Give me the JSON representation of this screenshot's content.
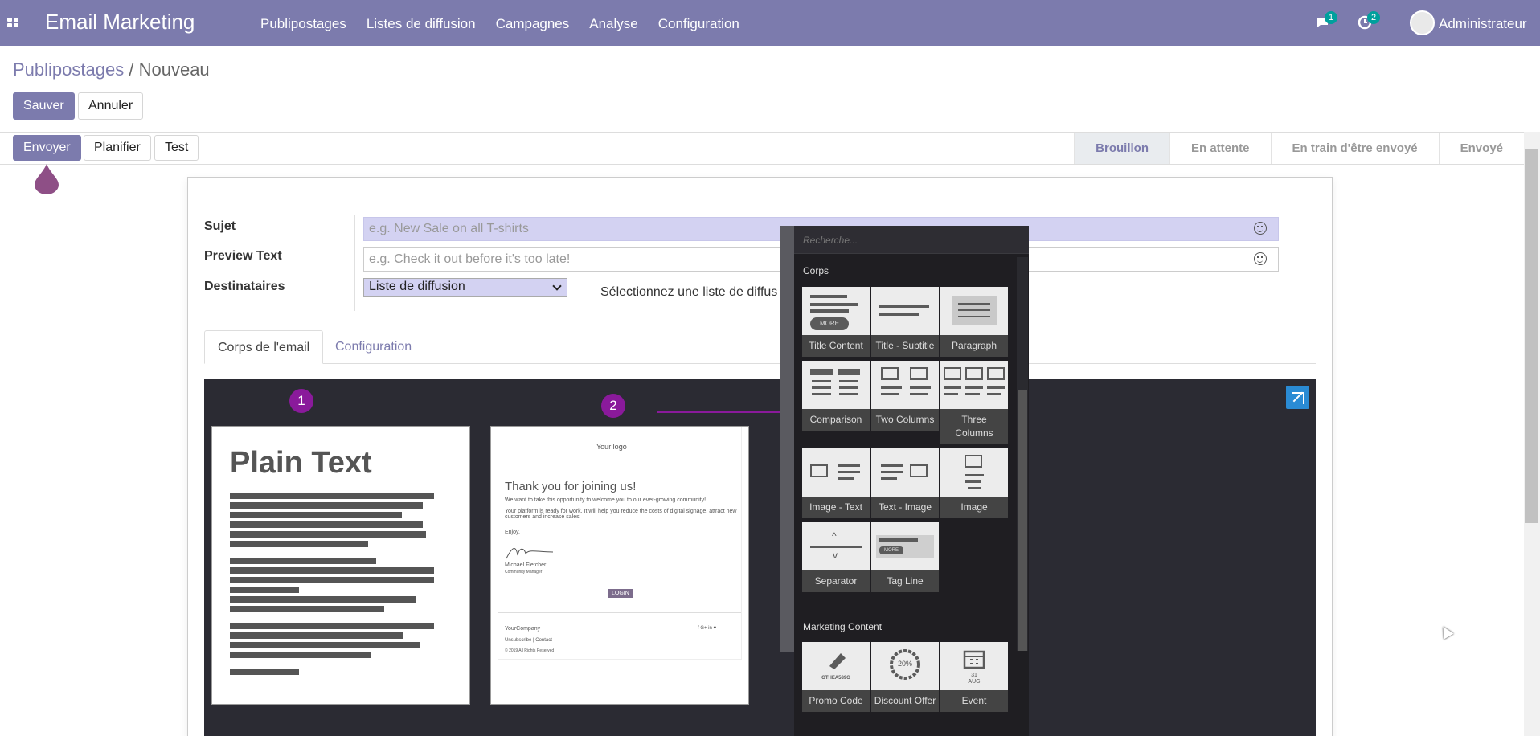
{
  "navbar": {
    "app_title": "Email Marketing",
    "menu": [
      "Publipostages",
      "Listes de diffusion",
      "Campagnes",
      "Analyse",
      "Configuration"
    ],
    "messages_count": "1",
    "activities_count": "2",
    "user": "Administrateur"
  },
  "breadcrumb": {
    "parent": "Publipostages",
    "separator": "/",
    "current": "Nouveau"
  },
  "actions": {
    "save": "Sauver",
    "discard": "Annuler"
  },
  "header_buttons": {
    "send": "Envoyer",
    "schedule": "Planifier",
    "test": "Test"
  },
  "stages": [
    "Brouillon",
    "En attente",
    "En train d'être envoyé",
    "Envoyé"
  ],
  "form": {
    "subject_label": "Sujet",
    "subject_placeholder": "e.g. New Sale on all T-shirts",
    "preview_label": "Preview Text",
    "preview_placeholder": "e.g. Check it out before it's too late!",
    "recipients_label": "Destinataires",
    "recipients_value": "Liste de diffusion",
    "recipients_hint": "Sélectionnez une liste de diffus"
  },
  "tabs": [
    "Corps de l'email",
    "Configuration"
  ],
  "templates": {
    "plain_text_title": "Plain Text",
    "marker_1": "1",
    "marker_2": "2",
    "welcome": {
      "logo": "Your logo",
      "heading": "Thank you for joining us!",
      "line1": "We want to take this opportunity to welcome you to our ever-growing community!",
      "line2": "Your platform is ready for work. It will help you reduce the costs of digital signage, attract new customers and increase sales.",
      "enjoy": "Enjoy,",
      "signer": "Michael Fletcher",
      "signer_role": "Community Manager",
      "login": "LOGIN",
      "company": "YourCompany",
      "links": "Unsubscribe | Contact",
      "copyright": "© 2019 All Rights Reserved",
      "social": "f  G+  in  ♥"
    }
  },
  "snippets": {
    "search_placeholder": "Recherche...",
    "section_body": "Corps",
    "section_marketing": "Marketing Content",
    "body": [
      "Title Content",
      "Title - Subtitle",
      "Paragraph",
      "Comparison",
      "Two Columns",
      "Three Columns",
      "Image - Text",
      "Text - Image",
      "Image",
      "Separator",
      "Tag Line"
    ],
    "marketing": [
      "Promo Code",
      "Discount Offer",
      "Event"
    ],
    "more_label": "MORE",
    "promo_label": "GTHEA589G",
    "discount_label": "20%",
    "event_day": "31",
    "event_month": "AUG"
  }
}
